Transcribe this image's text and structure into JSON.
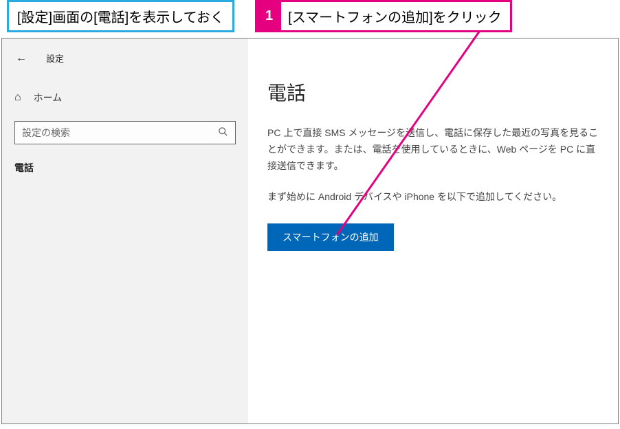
{
  "annotations": {
    "blue": "[設定]画面の[電話]を表示しておく",
    "pink_num": "1",
    "pink_text": "[スマートフォンの追加]をクリック"
  },
  "window": {
    "title": "設定",
    "home_label": "ホーム",
    "search_placeholder": "設定の検索",
    "nav_phone": "電話"
  },
  "main": {
    "heading": "電話",
    "description": "PC 上で直接 SMS メッセージを送信し、電話に保存した最近の写真を見ることができます。または、電話を使用しているときに、Web ページを PC に直接送信できます。",
    "instruction": "まず始めに Android デバイスや iPhone を以下で追加してください。",
    "button_label": "スマートフォンの追加"
  }
}
